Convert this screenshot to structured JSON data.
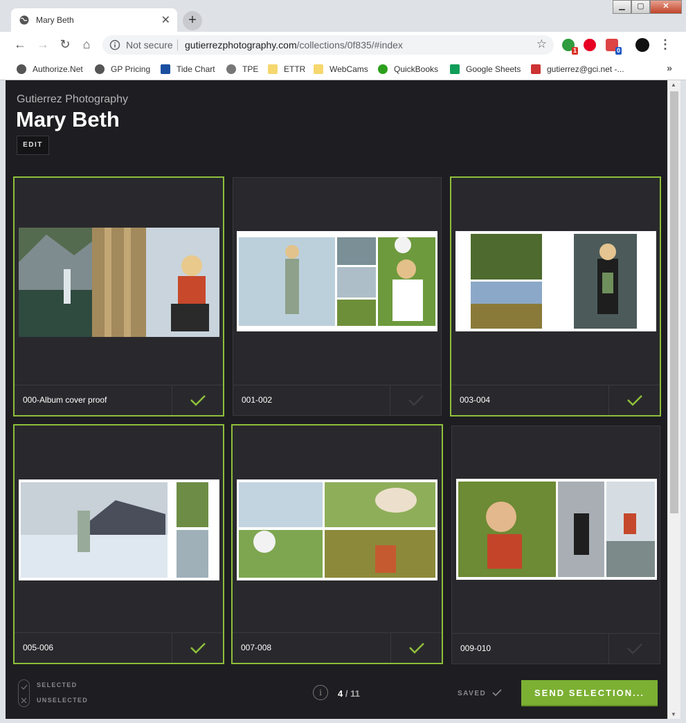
{
  "browser": {
    "tab_title": "Mary Beth",
    "new_tab": "+",
    "not_secure": "Not secure",
    "url_host": "gutierrezphotography.com",
    "url_path": "/collections/0f835/#index",
    "ext_badges": [
      "1",
      "0"
    ],
    "bookmarks": [
      {
        "label": "Authorize.Net",
        "color": "#555"
      },
      {
        "label": "GP Pricing",
        "color": "#555"
      },
      {
        "label": "Tide Chart",
        "color": "#1a4fa0"
      },
      {
        "label": "TPE",
        "color": "#777"
      },
      {
        "label": "ETTR",
        "color": "#f5d76e"
      },
      {
        "label": "WebCams",
        "color": "#f5d76e"
      },
      {
        "label": "QuickBooks",
        "color": "#2ca01c"
      },
      {
        "label": "Google Sheets",
        "color": "#0f9d58"
      },
      {
        "label": "gutierrez@gci.net -...",
        "color": "#c33"
      }
    ],
    "more": "»"
  },
  "header": {
    "studio": "Gutierrez Photography",
    "title": "Mary Beth",
    "edit": "EDIT"
  },
  "cards": [
    {
      "label": "000-Album cover proof",
      "selected": true
    },
    {
      "label": "001-002",
      "selected": false
    },
    {
      "label": "003-004",
      "selected": true
    },
    {
      "label": "005-006",
      "selected": true
    },
    {
      "label": "007-008",
      "selected": true
    },
    {
      "label": "009-010",
      "selected": false
    }
  ],
  "footer": {
    "selected": "SELECTED",
    "unselected": "UNSELECTED",
    "page_current": "4",
    "page_total": "/ 11",
    "saved": "SAVED",
    "send": "SEND SELECTION..."
  },
  "colors": {
    "accent": "#7cb033",
    "selected_border": "#8fbf3a",
    "background": "#1e1e22"
  }
}
